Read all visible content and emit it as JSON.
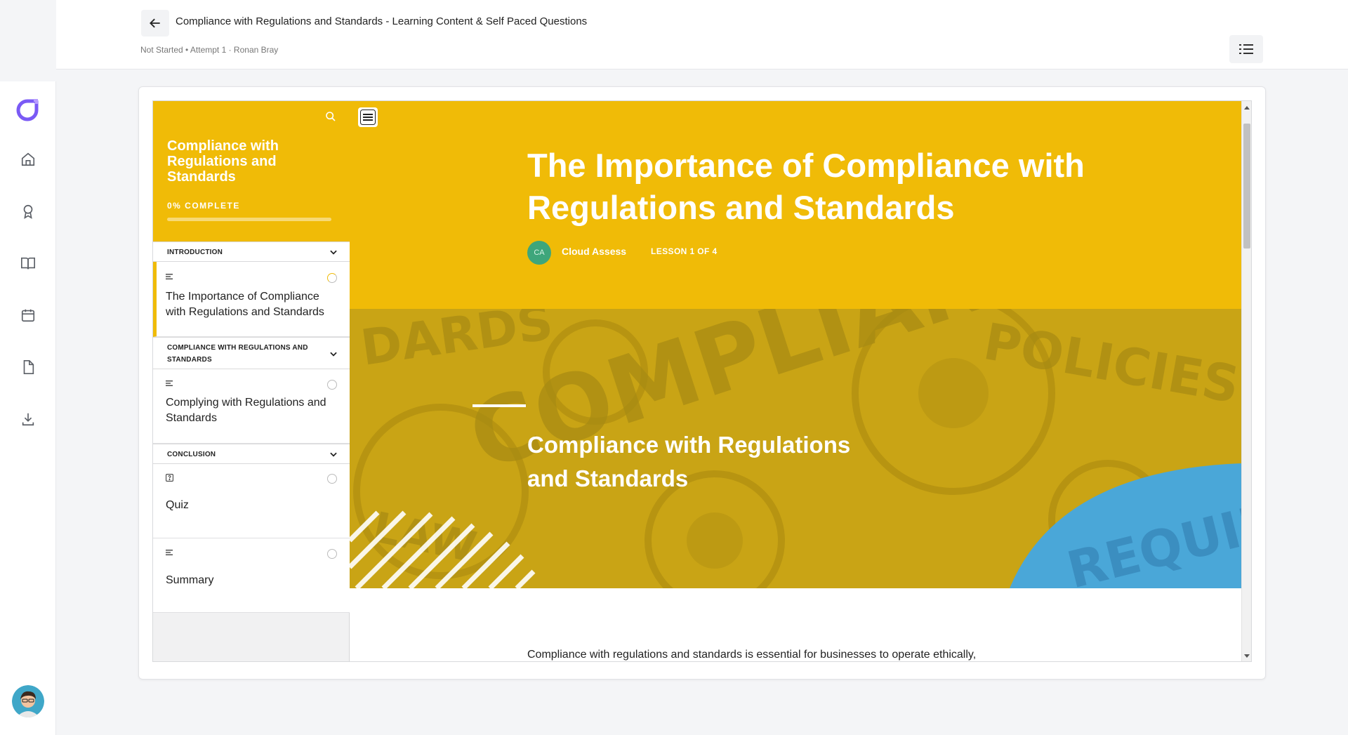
{
  "header": {
    "title": "Compliance with Regulations and Standards - Learning Content & Self Paced Questions",
    "subtitle": "Not Started • Attempt 1 · Ronan Bray"
  },
  "rail": {
    "icons": [
      "home-icon",
      "award-icon",
      "book-icon",
      "calendar-icon",
      "document-icon",
      "download-icon"
    ]
  },
  "course": {
    "title": "Compliance with Regulations and Standards",
    "progress_label": "0% COMPLETE",
    "progress": 0,
    "sections": [
      {
        "label": "INTRODUCTION",
        "lessons": [
          {
            "title": "The Importance of Compliance with Regulations and Standards",
            "type": "text",
            "status": "in-progress"
          }
        ]
      },
      {
        "label": "COMPLIANCE WITH REGULATIONS AND STANDARDS",
        "lessons": [
          {
            "title": "Complying with Regulations and Standards",
            "type": "text",
            "status": "not-started"
          }
        ]
      },
      {
        "label": "CONCLUSION",
        "lessons": [
          {
            "title": "Quiz",
            "type": "quiz",
            "status": "not-started"
          },
          {
            "title": "Summary",
            "type": "text",
            "status": "not-started"
          }
        ]
      }
    ]
  },
  "lesson": {
    "title": "The Importance of Compliance with Regulations and Standards",
    "author_initials": "CA",
    "author": "Cloud Assess",
    "counter": "LESSON 1 OF 4",
    "banner_title": "Compliance with Regulations and Standards",
    "banner_words": [
      "DARDS",
      "COMPLIANCE",
      "POLICIES",
      "LAW",
      "REQUIR"
    ],
    "body_first_line": "Compliance with regulations and standards is essential for businesses to operate ethically,"
  },
  "colors": {
    "accent": "#f0bb07",
    "author_avatar": "#3ea67b",
    "banner_blue": "#4aa7d8"
  }
}
